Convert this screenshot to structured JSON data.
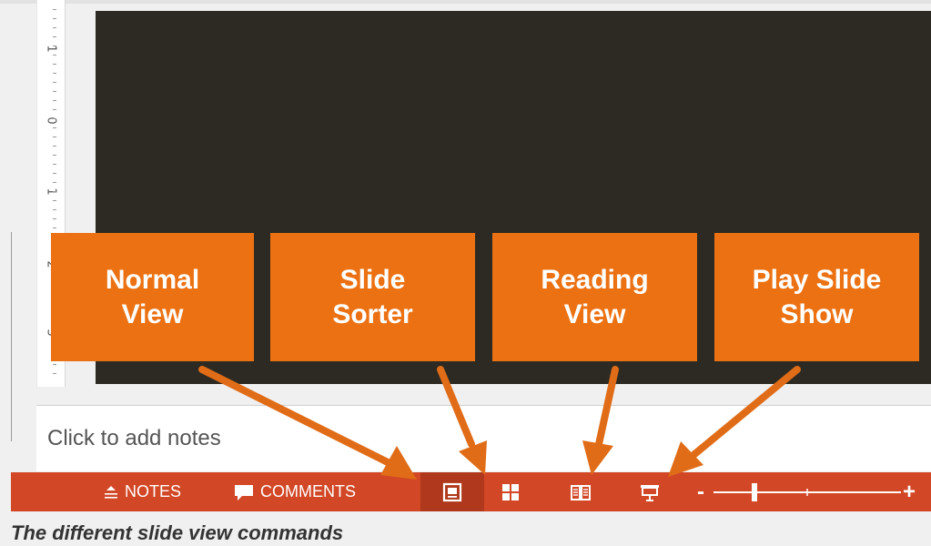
{
  "ruler": {
    "numbers": [
      "1",
      "0",
      "1",
      "2",
      "3"
    ]
  },
  "notes": {
    "placeholder": "Click to add notes"
  },
  "statusbar": {
    "notes_label": "NOTES",
    "comments_label": "COMMENTS",
    "zoom_minus": "-",
    "zoom_plus": "+",
    "color": "#d24726"
  },
  "callouts": [
    {
      "line1": "Normal",
      "line2": "View"
    },
    {
      "line1": "Slide",
      "line2": "Sorter"
    },
    {
      "line1": "Reading",
      "line2": "View"
    },
    {
      "line1": "Play Slide",
      "line2": "Show"
    }
  ],
  "caption": "The different slide view commands",
  "colors": {
    "callout": "#ec7113",
    "slide_bg": "#2c2a22",
    "active_view": "#b0381c"
  },
  "icons": [
    "notes-icon",
    "comments-icon",
    "normal-view-icon",
    "slide-sorter-icon",
    "reading-view-icon",
    "slide-show-icon"
  ]
}
